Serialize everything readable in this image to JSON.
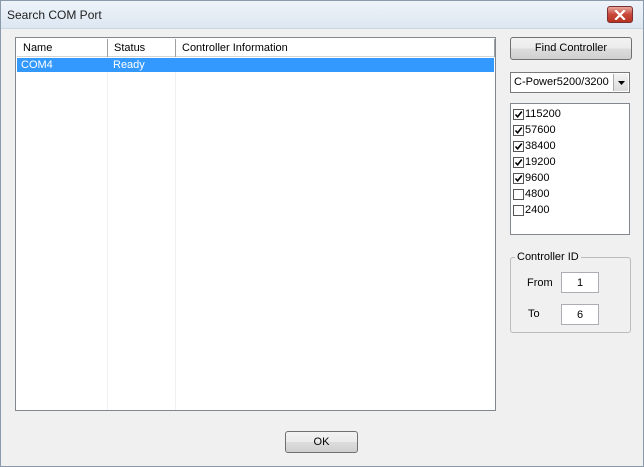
{
  "window": {
    "title": "Search COM Port"
  },
  "list": {
    "columns": [
      "Name",
      "Status",
      "Controller Information"
    ],
    "rows": [
      {
        "name": "COM4",
        "status": "Ready",
        "info": ""
      }
    ]
  },
  "buttons": {
    "find_controller": "Find Controller",
    "ok": "OK"
  },
  "controller_model": {
    "selected": "C-Power5200/3200"
  },
  "baud_rates": [
    {
      "label": "115200",
      "checked": true
    },
    {
      "label": "57600",
      "checked": true
    },
    {
      "label": "38400",
      "checked": true
    },
    {
      "label": "19200",
      "checked": true
    },
    {
      "label": "9600",
      "checked": true
    },
    {
      "label": "4800",
      "checked": false
    },
    {
      "label": "2400",
      "checked": false
    }
  ],
  "controller_id": {
    "group_label": "Controller ID",
    "from_label": "From",
    "from_value": "1",
    "to_label": "To",
    "to_value": "6"
  },
  "colors": {
    "selection": "#3399ff",
    "window_bg": "#f0f0f0"
  }
}
